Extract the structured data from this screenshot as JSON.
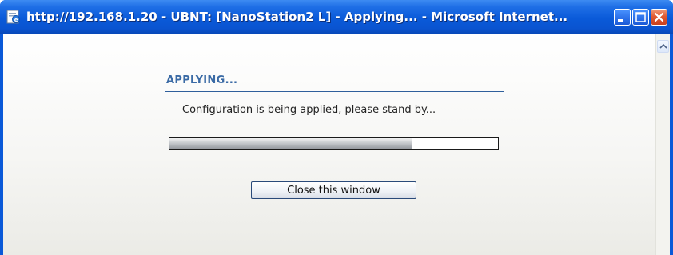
{
  "window": {
    "title": "http://192.168.1.20 - UBNT: [NanoStation2 L] - Applying... - Microsoft Internet...",
    "icons": {
      "app": "ie-page-icon",
      "minimize": "minimize-icon",
      "maximize": "maximize-icon",
      "close": "close-icon",
      "scroll_up": "chevron-up-icon"
    },
    "colors": {
      "titlebar": "#0a5ad9",
      "close_button": "#e15a32",
      "heading": "#3a6aa5"
    }
  },
  "dialog": {
    "heading": "APPLYING...",
    "message": "Configuration is being applied, please stand by...",
    "progress_fraction": 0.74,
    "close_button_label": "Close this window"
  }
}
